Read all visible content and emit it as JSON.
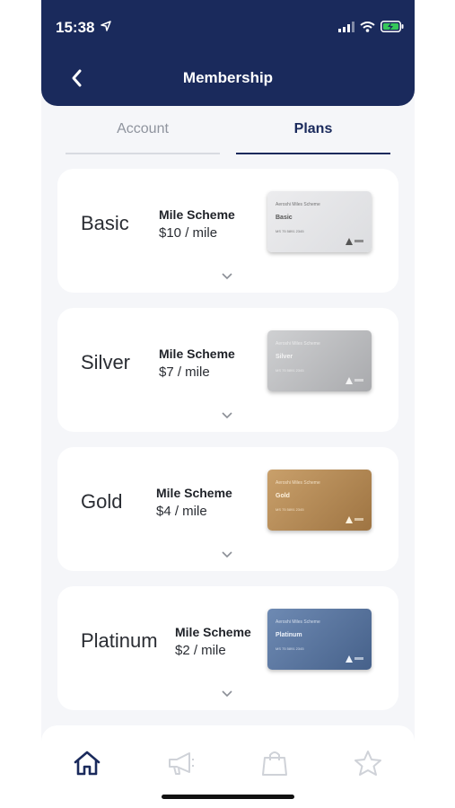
{
  "status": {
    "time": "15:38"
  },
  "header": {
    "title": "Membership"
  },
  "tabs": [
    {
      "label": "Account",
      "active": false
    },
    {
      "label": "Plans",
      "active": true
    }
  ],
  "plans": [
    {
      "name": "Basic",
      "scheme": "Mile Scheme",
      "price": "$10 / mile",
      "card": {
        "top": "Aeroshi Miles Scheme",
        "name": "Basic",
        "number": "MS 75 5891 2345"
      }
    },
    {
      "name": "Silver",
      "scheme": "Mile Scheme",
      "price": "$7 / mile",
      "card": {
        "top": "Aeroshi Miles Scheme",
        "name": "Silver",
        "number": "MS 75 5891 2345"
      }
    },
    {
      "name": "Gold",
      "scheme": "Mile Scheme",
      "price": "$4 / mile",
      "card": {
        "top": "Aeroshi Miles Scheme",
        "name": "Gold",
        "number": "MS 75 5891 2345"
      }
    },
    {
      "name": "Platinum",
      "scheme": "Mile Scheme",
      "price": "$2 / mile",
      "card": {
        "top": "Aeroshi Miles Scheme",
        "name": "Platinum",
        "number": "MS 75 5891 2345"
      }
    }
  ],
  "nav": [
    {
      "icon": "home-icon",
      "active": true
    },
    {
      "icon": "megaphone-icon",
      "active": false
    },
    {
      "icon": "shopping-bag-icon",
      "active": false
    },
    {
      "icon": "star-icon",
      "active": false
    }
  ],
  "colors": {
    "primary": "#1a2a5c",
    "background": "#f5f6f9",
    "card": "#ffffff"
  }
}
